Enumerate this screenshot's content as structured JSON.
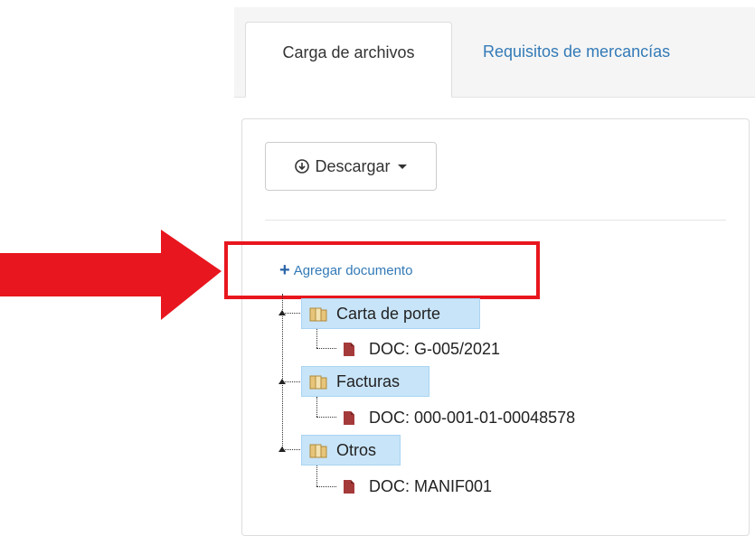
{
  "tabs": [
    {
      "label": "Carga de archivos",
      "active": true
    },
    {
      "label": "Requisitos de mercancías",
      "active": false
    }
  ],
  "toolbar": {
    "download_label": "Descargar"
  },
  "add_document_label": "Agregar documento",
  "tree": [
    {
      "folder": "Carta de porte",
      "doc": "DOC: G-005/2021"
    },
    {
      "folder": "Facturas",
      "doc": "DOC: 000-001-01-00048578"
    },
    {
      "folder": "Otros",
      "doc": "DOC: MANIF001"
    }
  ],
  "colors": {
    "accent": "#337ab7",
    "highlight": "#e8161e",
    "folder_bg": "#c8e4f8",
    "file_icon": "#a53a3a"
  }
}
